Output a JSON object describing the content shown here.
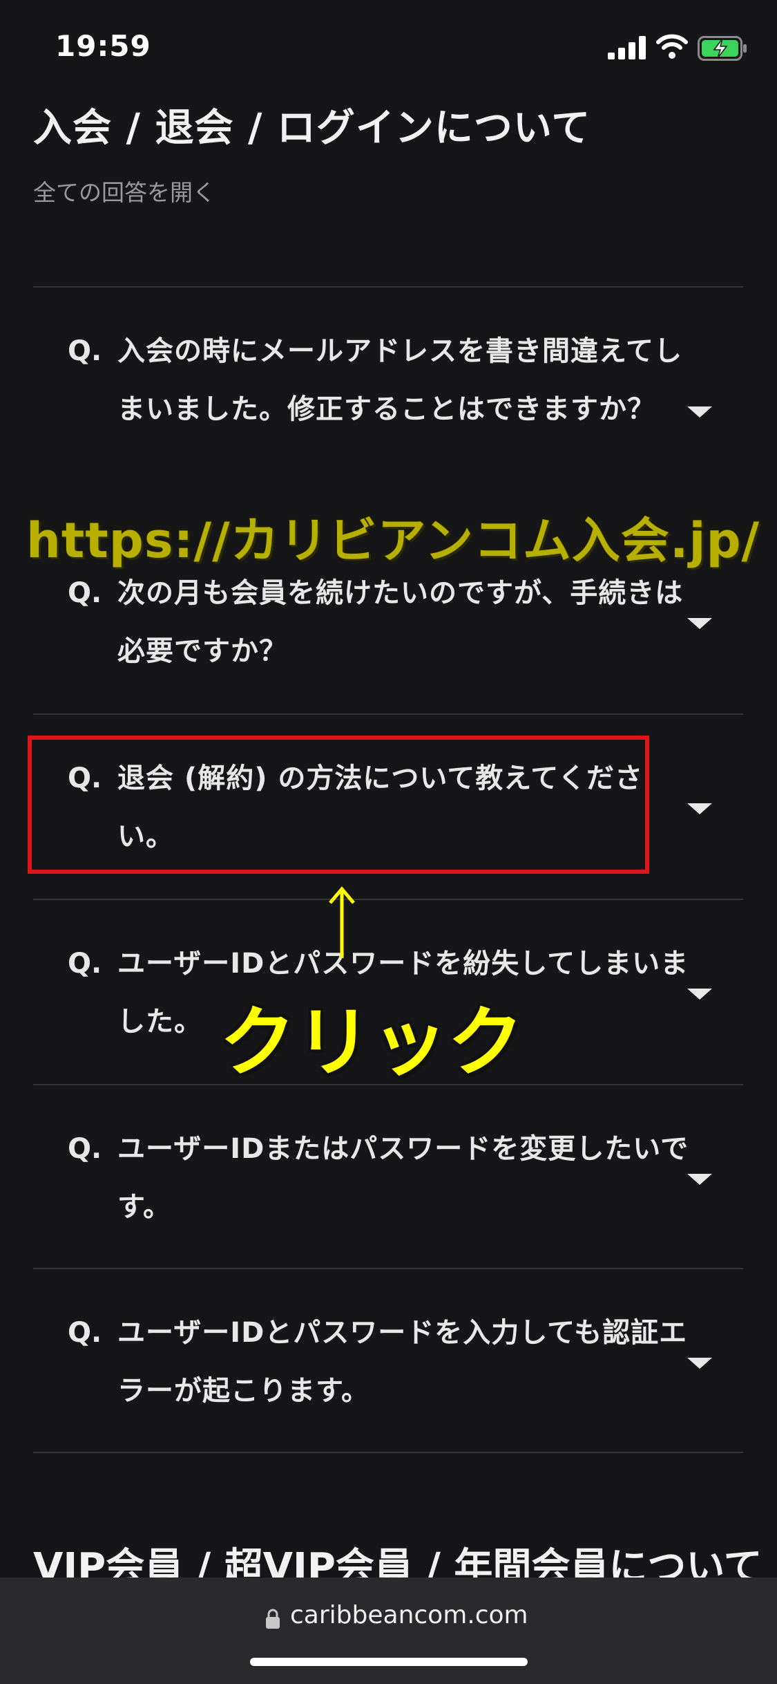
{
  "status": {
    "time": "19:59"
  },
  "section": {
    "title": "入会 / 退会 / ログインについて",
    "open_all": "全ての回答を開く"
  },
  "faq": [
    {
      "q": "Q.",
      "text": "入会の時にメールアドレスを書き間違えてしまいました。修正することはできますか？"
    },
    {
      "q": "Q.",
      "text": "次の月も会員を続けたいのですが、手続きは必要ですか？"
    },
    {
      "q": "Q.",
      "text": "退会 (解約) の方法について教えてください。"
    },
    {
      "q": "Q.",
      "text": "ユーザーIDとパスワードを紛失してしまいました。"
    },
    {
      "q": "Q.",
      "text": "ユーザーIDまたはパスワードを変更したいです。"
    },
    {
      "q": "Q.",
      "text": "ユーザーIDとパスワードを入力しても認証エラーが起こります。"
    }
  ],
  "annotations": {
    "watermark": "https://カリビアンコム入会.jp/",
    "click_label": "クリック",
    "arrow": "↑",
    "highlight_color": "#e0151a",
    "label_color": "#ffff00"
  },
  "next_section": {
    "title": "VIP会員 / 超VIP会員 / 年間会員について"
  },
  "browser": {
    "url": "caribbeancom.com"
  }
}
